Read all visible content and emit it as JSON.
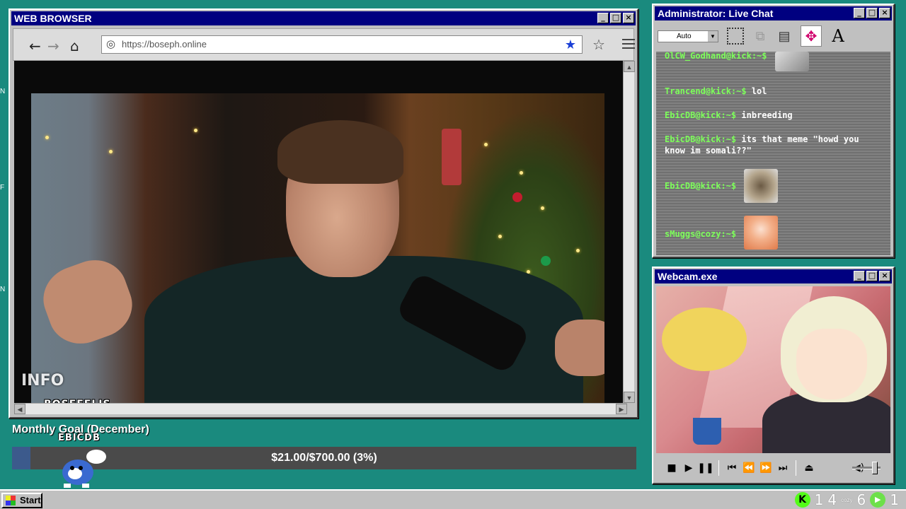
{
  "browser": {
    "title": "WEB BROWSER",
    "url": "https://boseph.online",
    "watermark": "BOSEFELIS",
    "watermark_logo": "INFO"
  },
  "goal": {
    "title": "Monthly Goal (December)",
    "user": "EBICDB",
    "text": "$21.00/$700.00 (3%)",
    "fraction": 0.03
  },
  "chat": {
    "title": "Administrator: Live Chat",
    "select_value": "Auto",
    "messages": [
      {
        "user": "OlCW_Godhand@kick:~$",
        "text": ""
      },
      {
        "user": "Trancend@kick:~$",
        "text": "lol"
      },
      {
        "user": "EbicDB@kick:~$",
        "text": "inbreeding"
      },
      {
        "user": "EbicDB@kick:~$",
        "text": "its that meme \"howd you know im somali??\""
      },
      {
        "user": "EbicDB@kick:~$",
        "text": ""
      },
      {
        "user": "sMuggs@cozy:~$",
        "text": ""
      }
    ]
  },
  "webcam": {
    "title": "Webcam.exe"
  },
  "taskbar": {
    "start": "Start",
    "kick_count": "1",
    "kick_count2": "4",
    "cozy_label": "cozy",
    "cozy_count": "6",
    "play_count": "1"
  },
  "colors": {
    "desktop": "#1a8a7e",
    "titlebar": "#000080",
    "chat_user": "#7dff5a",
    "goal_fill": "#3c5a8c",
    "kick_green": "#53fc18"
  }
}
